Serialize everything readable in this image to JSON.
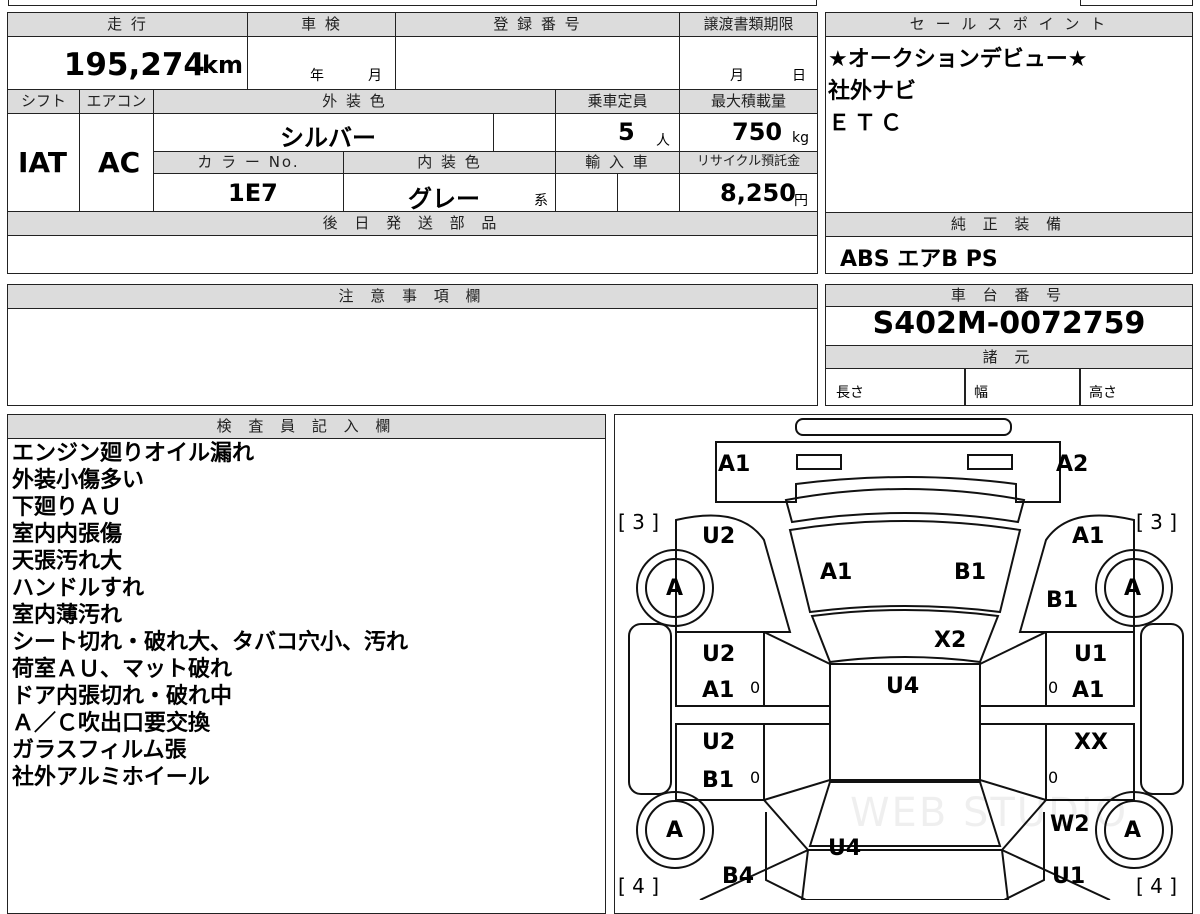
{
  "top_table": {
    "mileage_label": "走 行",
    "mileage_value": "195,274",
    "mileage_unit": "km",
    "inspection_label": "車 検",
    "year_unit": "年",
    "month_unit": "月",
    "reg_no_label": "登 録 番 号",
    "transfer_label": "譲渡書類期限",
    "transfer_month": "月",
    "transfer_day": "日",
    "shift_label": "シフト",
    "ac_label": "エアコン",
    "ext_color_label": "外 装 色",
    "capacity_label": "乗車定員",
    "max_load_label": "最大積載量",
    "shift_value": "IAT",
    "ac_value": "AC",
    "ext_color_value": "シルバー",
    "capacity_value": "5",
    "capacity_unit": "人",
    "max_load_value": "750",
    "max_load_unit": "kg",
    "color_no_label": "カ ラ ー No.",
    "int_color_label": "内 装 色",
    "import_label": "輸 入 車",
    "recycle_label": "リサイクル預託金",
    "color_no_value": "1E7",
    "int_color_value": "グレー",
    "int_color_suffix": "系",
    "recycle_value": "8,250",
    "recycle_unit": "円",
    "later_parts_label": "後 日 発 送 部 品"
  },
  "sales_points": {
    "label": "セ ー ル ス ポ イ ン ト",
    "lines": [
      "★オークションデビュー★",
      "社外ナビ",
      "ＥＴＣ"
    ]
  },
  "genuine_equipment": {
    "label": "純 正 装 備",
    "value": "ABS エアB PS"
  },
  "caution": {
    "label": "注 意 事 項 欄"
  },
  "chassis": {
    "label": "車 台 番 号",
    "value": "S402M-0072759"
  },
  "specs": {
    "label": "諸 元",
    "length": "長さ",
    "width": "幅",
    "height": "高さ"
  },
  "inspector": {
    "label": "検 査 員 記 入 欄",
    "notes": [
      "エンジン廻りオイル漏れ",
      "外装小傷多い",
      "下廻りＡＵ",
      "室内内張傷",
      "天張汚れ大",
      "ハンドルすれ",
      "室内薄汚れ",
      "シート切れ・破れ大、タバコ穴小、汚れ",
      "荷室ＡＵ、マット破れ",
      "ドア内張切れ・破れ中",
      "Ａ／Ｃ吹出口要交換",
      "ガラスフィルム張",
      "社外アルミホイール"
    ]
  },
  "diagram": {
    "front_left_bumper": "A1",
    "front_right_bumper": "A2",
    "left_tread_top": "[ 3 ]",
    "right_tread_top": "[ 3 ]",
    "left_tread_bottom": "[ 4 ]",
    "right_tread_bottom": "[ 4 ]",
    "left_front_fender": "U2",
    "right_front_fender_1": "A1",
    "right_front_fender_2": "B1",
    "hood_left": "A1",
    "hood_right": "B1",
    "wheel": "A",
    "windshield": "X2",
    "left_front_door_1": "U2",
    "left_front_door_2": "A1",
    "right_front_door_1": "U1",
    "right_front_door_2": "A1",
    "roof": "U4",
    "left_rear_door_1": "U2",
    "left_rear_door_2": "B1",
    "right_rear_door": "XX",
    "zero": "0",
    "rear_right_upper": "W2",
    "rear_center": "U4",
    "rear_left": "B4",
    "rear_right_lower": "U1",
    "watermark": "WEB STUDIO"
  }
}
